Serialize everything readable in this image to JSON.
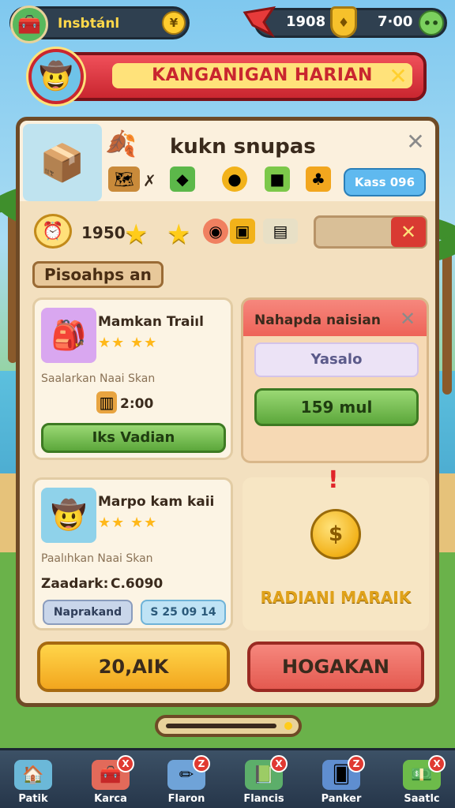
{
  "hud": {
    "player_name": "Insbtánl",
    "coin_btn": "¥",
    "gems": "1908",
    "time": "7·00",
    "shield": "♦"
  },
  "banner": {
    "title": "KANGANIGAN HARIAN",
    "close": "✕"
  },
  "panel": {
    "title": "kukn snupas",
    "close": "✕",
    "icon_x": "✗",
    "blue_pill": "Kass 096",
    "row2_value": "1950",
    "drop_x": "✕",
    "section_label": "Pisoahps an"
  },
  "quest1": {
    "title": "Mamkan Traiıl",
    "stars": "★★ ★★",
    "sub": "Saalarkan Naai Skan",
    "amount": "2:00",
    "button": "Iks  Vadian"
  },
  "red_card": {
    "title": "Nahapda naisian",
    "close": "✕",
    "lilac": "Yasalo",
    "green_button": "159 mul"
  },
  "quest2": {
    "title": "Marpo kam kaii",
    "stars": "★★ ★★",
    "sub": "Paalıhkan Naai Skan",
    "amount_label": "Zaadark:",
    "amount": "C.6090",
    "chip1": "Naprakand",
    "chip2": "S 25 09 14"
  },
  "reward": {
    "exclam": "!",
    "label": "RADIANI MARAIK"
  },
  "bottom": {
    "orange_btn": "20,AIK",
    "red_btn": "HOGAKAN"
  },
  "nav": {
    "items": [
      {
        "label": "Patik",
        "badge": ""
      },
      {
        "label": "Karca",
        "badge": "X"
      },
      {
        "label": "Flaron",
        "badge": "Z"
      },
      {
        "label": "Flancis",
        "badge": "X"
      },
      {
        "label": "Panker",
        "badge": "Z"
      },
      {
        "label": "Saatlc",
        "badge": "X"
      }
    ]
  },
  "colors": {
    "accent_red": "#c9262f",
    "accent_yellow": "#ffcc1a",
    "panel_bg": "#f3e0bf",
    "green": "#5ca73b"
  }
}
